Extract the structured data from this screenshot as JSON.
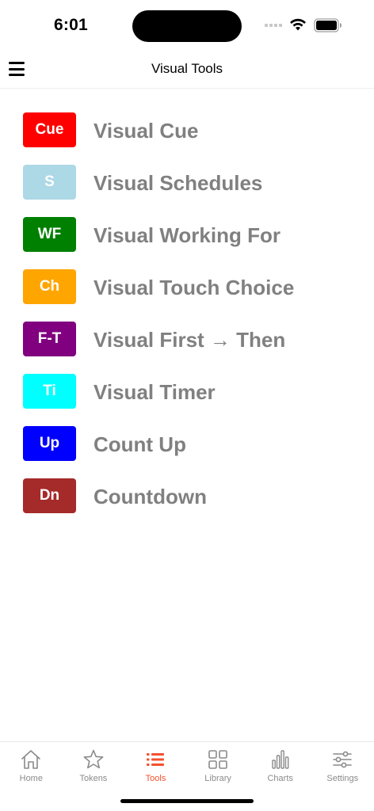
{
  "status_bar": {
    "time": "6:01"
  },
  "header": {
    "title": "Visual Tools"
  },
  "tools": [
    {
      "badge": "Cue",
      "label": "Visual Cue",
      "color": "#ff0000",
      "text_color": "#ffffff"
    },
    {
      "badge": "S",
      "label": "Visual Schedules",
      "color": "#add8e6",
      "text_color": "#ffffff"
    },
    {
      "badge": "WF",
      "label": "Visual Working For",
      "color": "#008000",
      "text_color": "#ffffff"
    },
    {
      "badge": "Ch",
      "label": "Visual Touch Choice",
      "color": "#ffa500",
      "text_color": "#ffffff"
    },
    {
      "badge": "F-T",
      "label": "Visual First → Then",
      "color": "#800080",
      "text_color": "#ffffff"
    },
    {
      "badge": "Ti",
      "label": "Visual Timer",
      "color": "#00ffff",
      "text_color": "#ffffff"
    },
    {
      "badge": "Up",
      "label": "Count Up",
      "color": "#0000ff",
      "text_color": "#ffffff"
    },
    {
      "badge": "Dn",
      "label": "Countdown",
      "color": "#a52a2a",
      "text_color": "#ffffff"
    }
  ],
  "tab_bar": {
    "active_color": "#f4502e",
    "inactive_color": "#8a8a8a",
    "tabs": [
      {
        "label": "Home",
        "icon": "home-icon",
        "active": false
      },
      {
        "label": "Tokens",
        "icon": "star-icon",
        "active": false
      },
      {
        "label": "Tools",
        "icon": "list-icon",
        "active": true
      },
      {
        "label": "Library",
        "icon": "grid-icon",
        "active": false
      },
      {
        "label": "Charts",
        "icon": "bar-chart-icon",
        "active": false
      },
      {
        "label": "Settings",
        "icon": "sliders-icon",
        "active": false
      }
    ]
  }
}
